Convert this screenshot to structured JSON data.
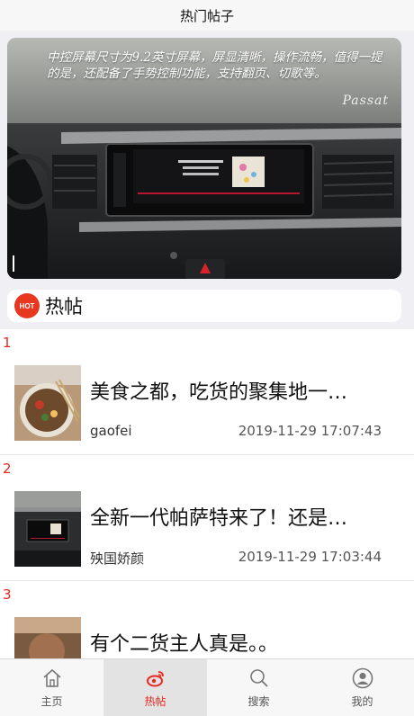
{
  "navbar": {
    "title": "热门帖子"
  },
  "banner": {
    "caption": "中控屏幕尺寸为9.2英寸屏幕，屏显清晰，操作流畅，值得一提的是，还配备了手势控制功能，支持翻页、切歌等。",
    "watermark": "Passat"
  },
  "section": {
    "badge": "HOT",
    "title": "热帖"
  },
  "posts": [
    {
      "rank": "1",
      "title": "美食之都，吃货的聚集地一…",
      "author": "gaofei",
      "time": "2019-11-29 17:07:43"
    },
    {
      "rank": "2",
      "title": "全新一代帕萨特来了！还是…",
      "author": "殃国娇颜",
      "time": "2019-11-29 17:03:44"
    },
    {
      "rank": "3",
      "title": "有个二货主人真是。。",
      "author": "",
      "time": ""
    }
  ],
  "tabs": [
    {
      "label": "主页",
      "icon": "home-icon",
      "active": false
    },
    {
      "label": "热帖",
      "icon": "weibo-icon",
      "active": true
    },
    {
      "label": "搜索",
      "icon": "search-icon",
      "active": false
    },
    {
      "label": "我的",
      "icon": "user-icon",
      "active": false
    }
  ],
  "colors": {
    "accent": "#e8271f",
    "background": "#efeff4"
  }
}
